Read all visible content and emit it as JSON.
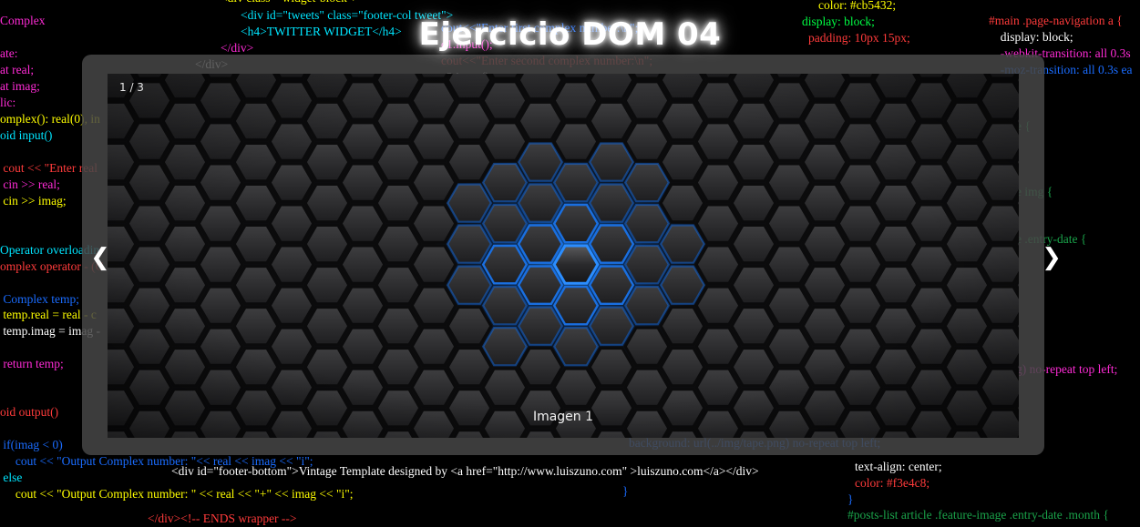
{
  "page": {
    "title": "Ejercicio DOM 04"
  },
  "slider": {
    "counter": "1 / 3",
    "caption": "Imagen 1",
    "prev_icon": "❮",
    "next_icon": "❯"
  },
  "background_code": {
    "left": [
      {
        "text": "Complex",
        "color": "#ff2bd6"
      },
      {
        "text": "ate:",
        "color": "#ff2bd6"
      },
      {
        "text": "at real;",
        "color": "#ff2bd6"
      },
      {
        "text": "at imag;",
        "color": "#ff2bd6"
      },
      {
        "text": "lic:",
        "color": "#ff2bd6"
      },
      {
        "text": "omplex(): real(0), in",
        "color": "#ffff00"
      },
      {
        "text": "oid input()",
        "color": "#00e5ff"
      },
      {
        "text": " cout << \"Enter real",
        "color": "#ff3b3b"
      },
      {
        "text": " cin >> real;",
        "color": "#ff2bd6"
      },
      {
        "text": " cin >> imag;",
        "color": "#ffff00"
      },
      {
        "text": "Operator overloadin",
        "color": "#00e5ff"
      },
      {
        "text": "omplex operator - (C",
        "color": "#ff3b3b"
      },
      {
        "text": " Complex temp;",
        "color": "#1a6cff"
      },
      {
        "text": " temp.real = real - c",
        "color": "#ffff00"
      },
      {
        "text": " temp.imag = imag -",
        "color": "#ffffff"
      },
      {
        "text": " return temp;",
        "color": "#ff2bd6"
      },
      {
        "text": "oid output()",
        "color": "#ff3b3b"
      },
      {
        "text": " if(imag < 0)",
        "color": "#1a6cff"
      },
      {
        "text": "     cout << \"Output Complex number: \"<< real << imag << \"i\";",
        "color": "#1a6cff"
      },
      {
        "text": " else",
        "color": "#00e5ff"
      },
      {
        "text": "     cout << \"Output Complex number: \" << real << \"+\" << imag << \"i\";",
        "color": "#ffff00"
      }
    ],
    "top_center": [
      {
        "text": "<div class=\"widget-block\">",
        "color": "#ffff00"
      },
      {
        "text": "<div id=\"tweets\" class=\"footer-col tweet\">",
        "color": "#00e5ff"
      },
      {
        "text": "<h4>TWITTER WIDGET</h4>",
        "color": "#00e5ff"
      },
      {
        "text": "</div>",
        "color": "#ff2bd6"
      },
      {
        "text": "</div>",
        "color": "#ffffff"
      }
    ],
    "top_mid": [
      {
        "text": "cout<<\"Enter first complex number:\\n\";",
        "color": "#1a6cff"
      },
      {
        "text": "c1.input();",
        "color": "#ff2bd6"
      },
      {
        "text": "cout<<\"Enter second complex number:\\n\";",
        "color": "#ff3b3b"
      },
      {
        "text": "c2.input();",
        "color": "#ffffff"
      }
    ],
    "top_right": [
      {
        "text": "color: #cb5432;",
        "color": "#ffff00"
      },
      {
        "text": "display: block;",
        "color": "#00ff44"
      },
      {
        "text": "padding: 10px 15px;",
        "color": "#ff3b3b"
      }
    ],
    "right": [
      {
        "text": "#main .page-navigation a {",
        "color": "#ff3b3b"
      },
      {
        "text": "  display: block;",
        "color": "#ffffff"
      },
      {
        "text": "  -webkit-transition: all 0.3s",
        "color": "#ff2bd6"
      },
      {
        "text": "  -moz-transition: all 0.3s ea",
        "color": "#1a6cff"
      },
      {
        "text": "e {",
        "color": "#1aa34a"
      },
      {
        "text": "e img {",
        "color": "#1aa34a"
      },
      {
        "text": "e .entry-date {",
        "color": "#1aa34a"
      },
      {
        "text": "g) no-repeat top left;",
        "color": "#ff2bd6"
      }
    ],
    "bottom": [
      {
        "text": "background: url(../img/tape.png) no-repeat top left;",
        "color": "#1a6cff"
      },
      {
        "text": "<div id=\"footer-bottom\">Vintage Template designed by <a href=\"http://www.luiszuno.com\" >luiszuno.com</a></div>",
        "color": "#ffffff"
      },
      {
        "text": "}",
        "color": "#1a6cff"
      },
      {
        "text": "</div><!-- ENDS wrapper -->",
        "color": "#ff3b3b"
      },
      {
        "text": "text-align: center;",
        "color": "#ffffff"
      },
      {
        "text": "color: #f3e4c8;",
        "color": "#ff3b3b"
      },
      {
        "text": "}",
        "color": "#1a6cff"
      },
      {
        "text": "#posts-list article .feature-image .entry-date .month {",
        "color": "#1aa34a"
      }
    ]
  }
}
